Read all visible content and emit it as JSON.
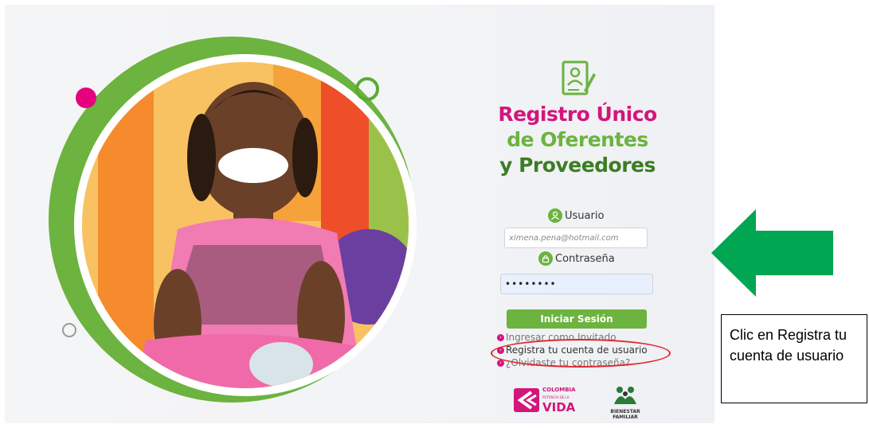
{
  "brand": {
    "line1": "Registro Único",
    "line2": "de Oferentes",
    "line3": "y Proveedores",
    "colors": {
      "pink": "#d3157c",
      "green": "#6cb33f",
      "dark_green": "#3b7d23"
    }
  },
  "login": {
    "user_label": "Usuario",
    "user_value": "ximena.pena@hotmail.com",
    "password_label": "Contraseña",
    "password_value": "••••••••",
    "submit_label": "Iniciar Sesión"
  },
  "links": {
    "guest": "Ingresar como Invitado",
    "register": "Registra tu cuenta de usuario",
    "forgot": "¿Olvidaste tu contraseña?"
  },
  "footer_logos": {
    "colombia_line1": "COLOMBIA",
    "colombia_line2": "POTENCIA DE LA",
    "colombia_line3": "VIDA",
    "bienestar_line1": "BIENESTAR",
    "bienestar_line2": "FAMILIAR"
  },
  "annotation": {
    "callout_text": "Clic en Registra tu cuenta de usuario",
    "arrow_color": "#00a651",
    "highlight_color": "#e0262d"
  },
  "icons": [
    "document-user-icon",
    "user-icon",
    "lock-icon",
    "arrow-left-icon"
  ]
}
